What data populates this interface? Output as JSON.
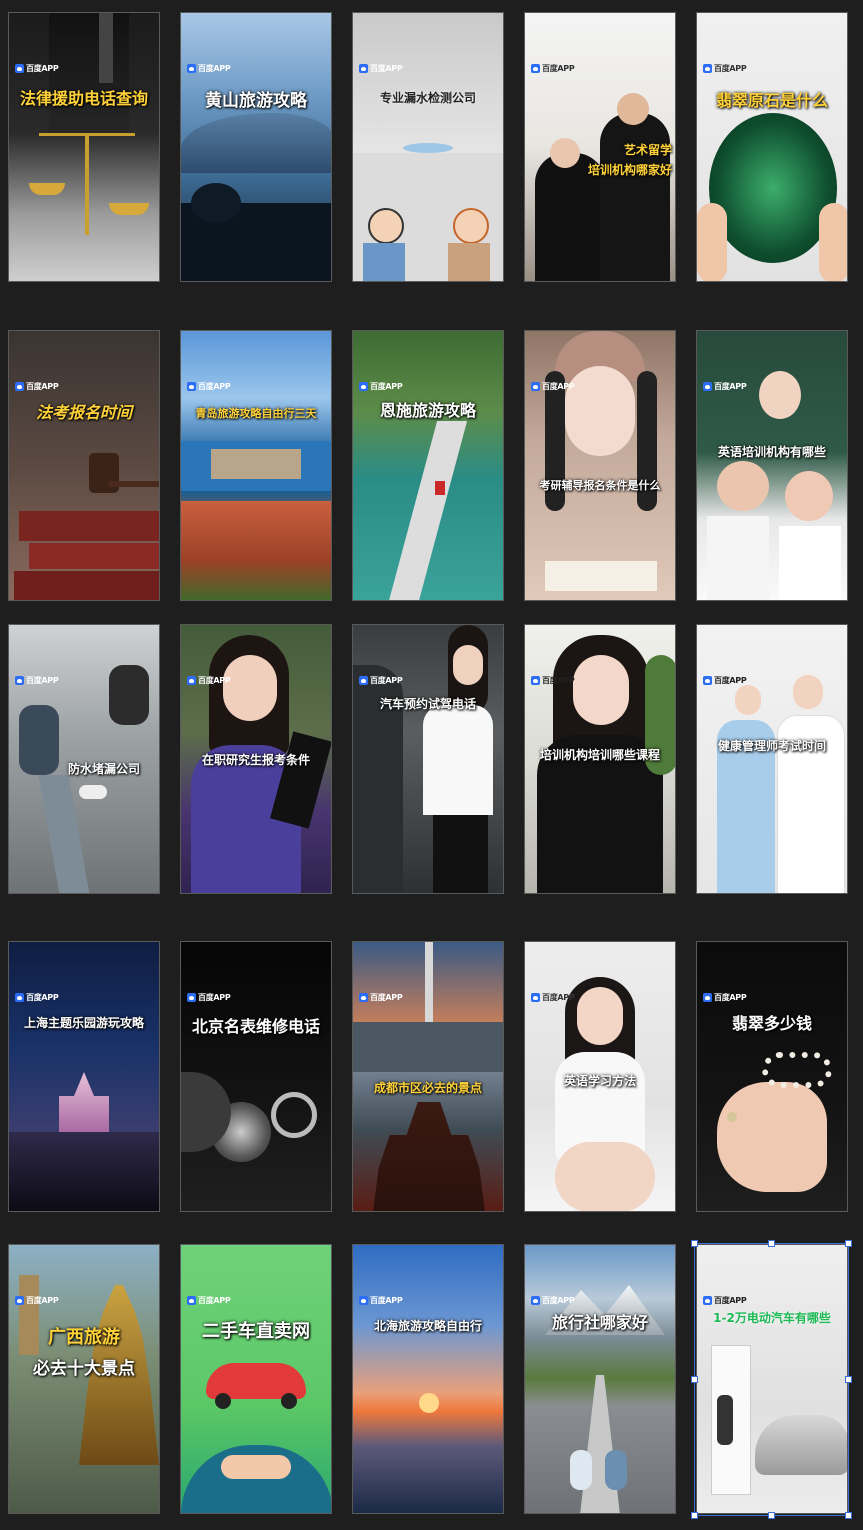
{
  "brand": "百度APP",
  "cards": [
    {
      "title": "法律援助电话查询"
    },
    {
      "title": "黄山旅游攻略"
    },
    {
      "title": "专业漏水检测公司"
    },
    {
      "title": "艺术留学",
      "title2": "培训机构哪家好"
    },
    {
      "title": "翡翠原石是什么"
    },
    {
      "title": "法考报名时间"
    },
    {
      "title": "青岛旅游攻略自由行三天"
    },
    {
      "title": "恩施旅游攻略"
    },
    {
      "title": "考研辅导报名条件是什么"
    },
    {
      "title": "英语培训机构有哪些"
    },
    {
      "title": "防水堵漏公司"
    },
    {
      "title": "在职研究生报考条件"
    },
    {
      "title": "汽车预约试驾电话"
    },
    {
      "title": "培训机构培训哪些课程"
    },
    {
      "title": "健康管理师考试时间"
    },
    {
      "title": "上海主题乐园游玩攻略"
    },
    {
      "title": "北京名表维修电话"
    },
    {
      "title": "成都市区必去的景点"
    },
    {
      "title": "英语学习方法"
    },
    {
      "title": "翡翠多少钱"
    },
    {
      "title": "广西旅游",
      "title2": "必去十大景点"
    },
    {
      "title": "二手车直卖网"
    },
    {
      "title": "北海旅游攻略自由行"
    },
    {
      "title": "旅行社哪家好"
    },
    {
      "title": "1-2万电动汽车有哪些"
    }
  ]
}
